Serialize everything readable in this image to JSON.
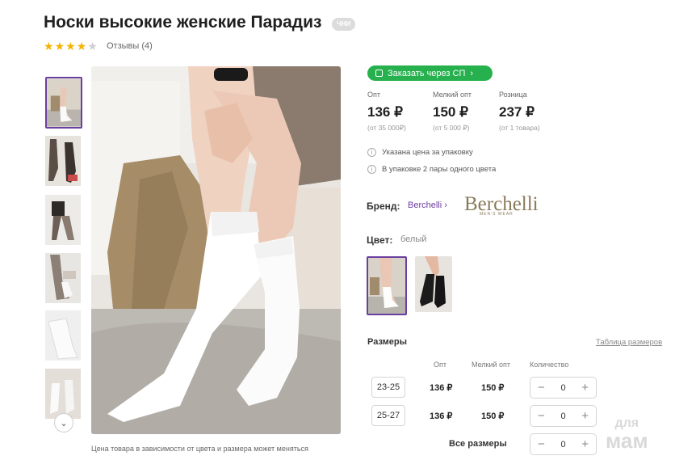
{
  "product": {
    "title": "Носки высокие женские Парадиз",
    "badge": "ЧНИ",
    "rating": 4,
    "reviews_label": "Отзывы (4)"
  },
  "gallery": {
    "caption": "Цена товара в зависимости от цвета и размера может меняться",
    "thumbnail_count": 6,
    "scroll_icon": "chevron-down-icon"
  },
  "order_button": {
    "label": "Заказать через СП",
    "icon": "bag-icon",
    "color": "#27b14e"
  },
  "prices": [
    {
      "label": "Опт",
      "value": "136 ₽",
      "min": "(от 35 000₽)"
    },
    {
      "label": "Мелкий опт",
      "value": "150 ₽",
      "min": "(от 5 000 ₽)"
    },
    {
      "label": "Розница",
      "value": "237 ₽",
      "min": "(от 1 товара)"
    }
  ],
  "info": [
    "Указана цена за упаковку",
    "В упаковке 2 пары одного цвета"
  ],
  "brand": {
    "label": "Бренд:",
    "name": "Berchelli",
    "logo_text": "Berchelli",
    "logo_sub": "MEN'S WEAR"
  },
  "color": {
    "label": "Цвет:",
    "value": "белый",
    "options": [
      "белый",
      "черный"
    ]
  },
  "sizes": {
    "title": "Размеры",
    "table_link": "Таблица размеров",
    "headers": {
      "opt": "Опт",
      "small_opt": "Мелкий опт",
      "qty": "Количество"
    },
    "rows": [
      {
        "size": "23-25",
        "opt": "136 ₽",
        "small_opt": "150 ₽",
        "qty": "0"
      },
      {
        "size": "25-27",
        "opt": "136 ₽",
        "small_opt": "150 ₽",
        "qty": "0"
      }
    ],
    "all_label": "Все размеры",
    "all_qty": "0"
  },
  "watermark": {
    "line1": "для",
    "line2": "мам"
  },
  "colors": {
    "accent": "#6b3fa0",
    "green": "#27b14e",
    "star": "#f4b400"
  }
}
